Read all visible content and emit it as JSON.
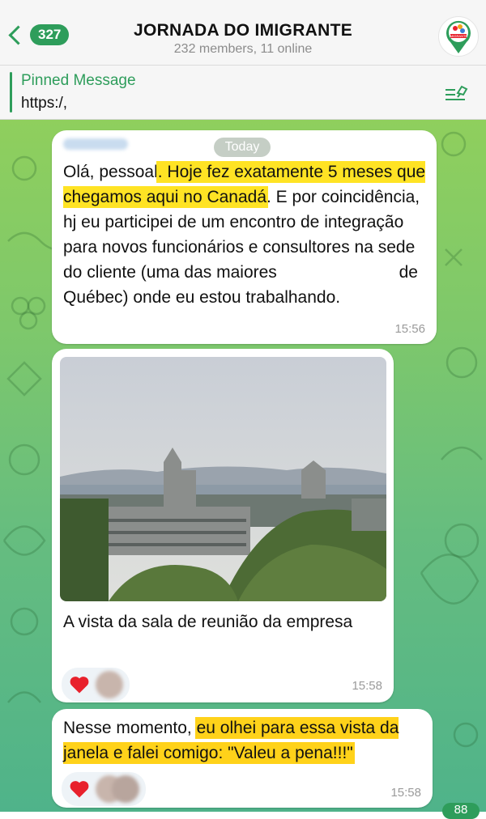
{
  "header": {
    "back_count": "327",
    "title": "JORNADA DO IMIGRANTE",
    "subtitle": "232 members, 11 online",
    "avatar_icon": "map-pin-logo",
    "avatar_text": "IMIGRANTE"
  },
  "pinned": {
    "title": "Pinned Message",
    "text": "https:/,"
  },
  "chat": {
    "date_label": "Today",
    "messages": [
      {
        "part1": "Olá, pessoal",
        "highlight1": ". Hoje fez exatamente 5 meses que chegamos aqui no Canadá",
        "part2": ". E por coincidência, hj eu participei de um encontro de integração para novos funcionários e consultores na sede do cliente (uma das  maiores",
        "part3": " de Québec) onde eu estou trabalhando.",
        "time": "15:56"
      },
      {
        "caption": "A vista da sala de reunião da empresa",
        "time": "15:58"
      },
      {
        "part1": "Nesse momento, ",
        "highlight1": "eu olhei para essa vista da janela e falei comigo: \"Valeu a pena!!!\"",
        "time": "15:58"
      }
    ],
    "unread_badge": "88"
  },
  "colors": {
    "accent": "#2e9d5b",
    "highlight": "#ffe324",
    "heart": "#e8212c"
  }
}
